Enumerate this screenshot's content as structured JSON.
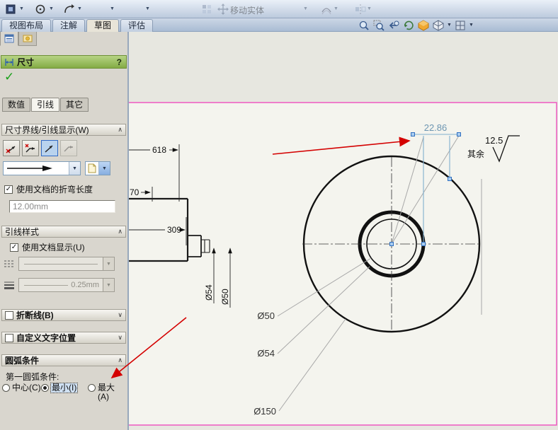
{
  "icons": {
    "caret": "▼",
    "chevron_expanded": "∧",
    "chevron_collapsed": "∨",
    "check": "✓",
    "ok_check": "✓"
  },
  "top_toolbar": {
    "move_entities_label": "移动实体"
  },
  "command_tabs": [
    {
      "label": "视图布局",
      "active": false
    },
    {
      "label": "注解",
      "active": false
    },
    {
      "label": "草图",
      "active": true
    },
    {
      "label": "评估",
      "active": false
    }
  ],
  "property_panel": {
    "title": "尺寸",
    "help_label": "?",
    "tabs": [
      {
        "label": "数值",
        "active": false
      },
      {
        "label": "引线",
        "active": true
      },
      {
        "label": "其它",
        "active": false
      }
    ],
    "witness_group": {
      "title": "尺寸界线/引线显示(W)"
    },
    "bend_checkbox_label": "使用文档的折弯长度",
    "bend_length_value": "12.00mm",
    "leader_style_group": {
      "title": "引线样式",
      "use_doc_label": "使用文档显示(U)",
      "thickness_value": "0.25mm"
    },
    "break_lines_group": {
      "title": "折断线(B)"
    },
    "custom_text_group": {
      "title": "自定义文字位置"
    },
    "arc_group": {
      "title": "圆弧条件",
      "condition_label": "第一圆弧条件:",
      "options": [
        {
          "label": "中心(C)",
          "selected": false
        },
        {
          "label": "最小(I)",
          "selected": true
        },
        {
          "label": "最大(A)",
          "selected": false
        }
      ]
    }
  },
  "drawing": {
    "dim_618": "618",
    "dim_70": "70",
    "dim_309": "309",
    "dim_phi54_side": "Ø54",
    "dim_phi50_side": "Ø50",
    "selected_dim": "22.86",
    "roughness_value": "12.5",
    "roughness_note": "其余",
    "leader_phi50": "Ø50",
    "leader_phi54": "Ø54",
    "leader_phi150": "Ø150"
  },
  "colors": {
    "sheet_border": "#ee58c0",
    "selected_dim_blue": "#6d96b2",
    "annotation_red": "#d40000",
    "panel_header_green": "#8fbf4e"
  }
}
